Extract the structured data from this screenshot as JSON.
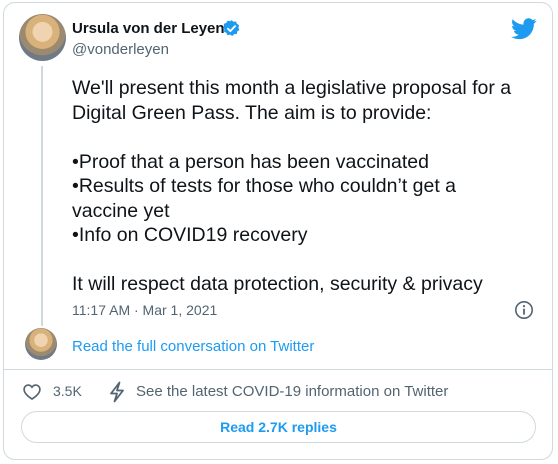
{
  "author": {
    "name": "Ursula von der Leyen",
    "handle": "@vonderleyen",
    "verified": true
  },
  "tweet": {
    "lines": [
      "We'll present this month a legislative proposal for a",
      "Digital Green Pass. The aim is to provide:",
      "",
      "•Proof that a person has been vaccinated",
      "•Results of tests for those who couldn’t get a",
      "vaccine yet",
      "•Info on COVID19 recovery",
      "",
      "It will respect data protection, security & privacy"
    ],
    "timestamp": "11:17 AM · Mar 1, 2021"
  },
  "conversation": {
    "link_label": "Read the full conversation on Twitter"
  },
  "actions": {
    "like_count": "3.5K",
    "covid_label": "See the latest COVID-19 information on Twitter",
    "replies_label": "Read 2.7K replies"
  },
  "icons": {
    "brand": "twitter-bird-icon",
    "verified": "verified-badge-icon",
    "info": "info-icon",
    "like": "heart-icon",
    "covid": "lightning-bolt-icon"
  },
  "colors": {
    "accent": "#1d9bf0",
    "text": "#0f1419",
    "muted": "#536471",
    "border": "#cfd9de"
  }
}
